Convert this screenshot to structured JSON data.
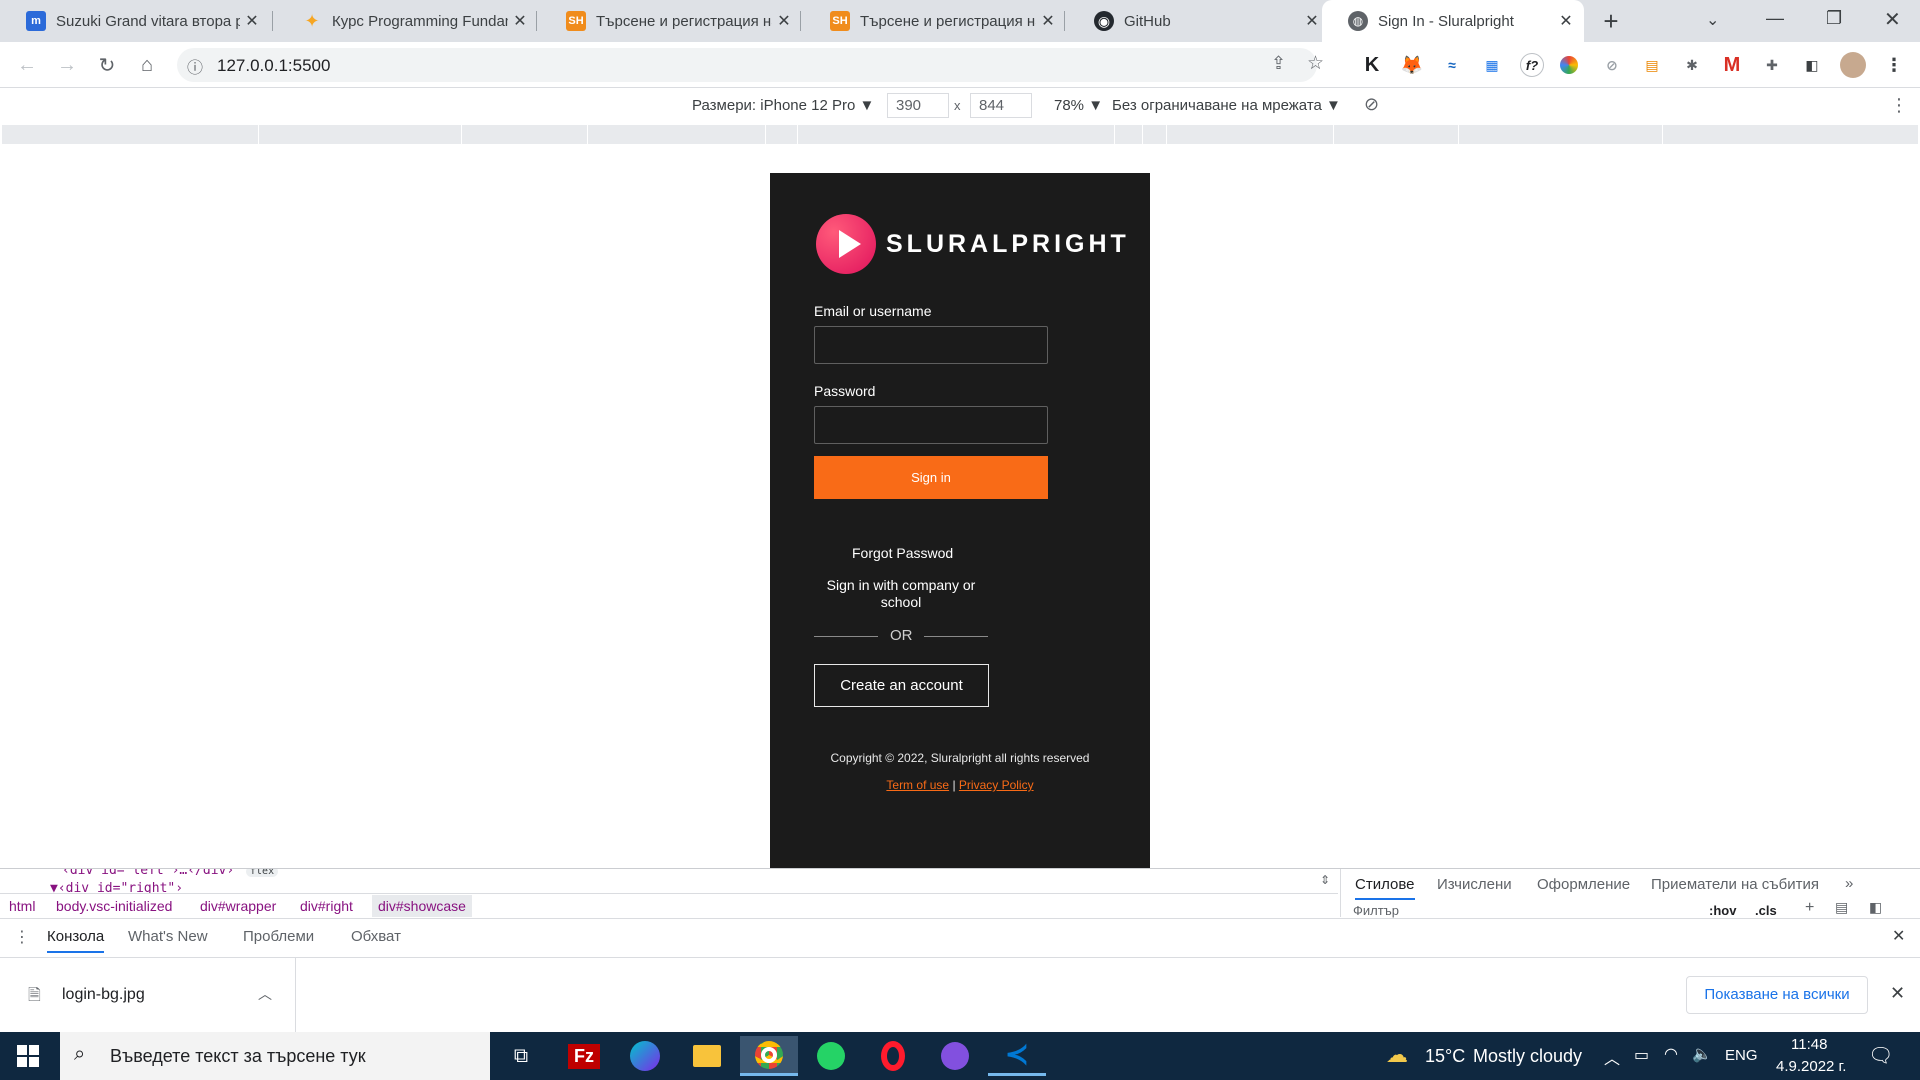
{
  "tabs": [
    {
      "title": "Suzuki Grand vitara втора р",
      "favicon": "m",
      "color": "#2b6ad9"
    },
    {
      "title": "Курс Programming Fundam",
      "favicon": "✦",
      "color": "#f6a623"
    },
    {
      "title": "Търсене и регистрация на",
      "favicon": "SH",
      "color": "#f08c1c"
    },
    {
      "title": "Търсене и регистрация на",
      "favicon": "SH",
      "color": "#f08c1c"
    },
    {
      "title": "GitHub",
      "favicon": "◉",
      "color": "#24292f"
    },
    {
      "title": "Sign In - Sluralpright",
      "favicon": "◍",
      "color": "#5f6368"
    }
  ],
  "new_tab": "+",
  "address": {
    "url": "127.0.0.1:5500"
  },
  "device_toolbar": {
    "size_label": "Размери: iPhone 12 Pro ▼",
    "width": "390",
    "times": "x",
    "height": "844",
    "zoom": "78% ▼",
    "throttle": "Без ограничаване на мрежата ▼"
  },
  "login": {
    "brand": "SLURALPRIGHT",
    "email_label": "Email or username",
    "password_label": "Password",
    "sign_in": "Sign in",
    "forgot": "Forgot Passwod",
    "company_line1": "Sign in with company or",
    "company_line2": "school",
    "or": "OR",
    "create": "Create an account",
    "copyright": "Copyright © 2022, Sluralpright all rights reserved",
    "terms": "Term of use",
    "sep": "|",
    "privacy": "Privacy Policy",
    "accent": "#f96b17"
  },
  "devtools": {
    "code_line1": "‹div id=\"left\"›…‹/div›",
    "flex_badge": "flex",
    "code_line2": "▼‹div id=\"right\"›",
    "breadcrumbs": [
      "html",
      "body.vsc-initialized",
      "div#wrapper",
      "div#right",
      "div#showcase"
    ],
    "styles_tabs": [
      "Стилове",
      "Изчислени",
      "Оформление",
      "Приематели на събития",
      "»"
    ],
    "filter_placeholder": "Филтър",
    "hov": ":hov",
    "cls": ".cls",
    "drawer_tabs": [
      "Конзола",
      "What's New",
      "Проблеми",
      "Обхват"
    ]
  },
  "download": {
    "file": "login-bg.jpg",
    "show_all": "Показване на всички"
  },
  "taskbar": {
    "search_placeholder": "Въведете текст за търсене тук",
    "weather_temp": "15°C",
    "weather_text": "Mostly cloudy",
    "lang": "ENG",
    "time": "11:48",
    "date": "4.9.2022 г."
  }
}
